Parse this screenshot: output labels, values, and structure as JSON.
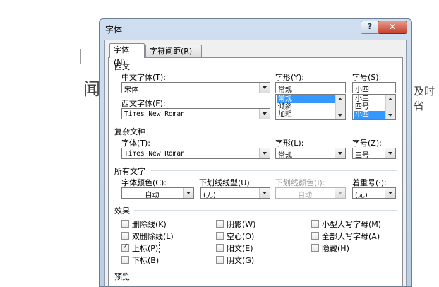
{
  "background": {
    "left_char": "闻",
    "right_text": "及时省"
  },
  "dialog": {
    "title": "字体",
    "help_label": "?",
    "close_label": "✕",
    "tabs": [
      {
        "label": "字体(N)",
        "active": true
      },
      {
        "label": "字符间距(R)",
        "active": false
      }
    ],
    "western": {
      "heading": "西文",
      "chinese_font_label": "中文字体(T):",
      "chinese_font_value": "宋体",
      "western_font_label": "西文字体(F):",
      "western_font_value": "Times New Roman",
      "style_label": "字形(Y):",
      "style_value": "常规",
      "style_options": [
        "常规",
        "倾斜",
        "加粗"
      ],
      "style_selected": "常规",
      "size_label": "字号(S):",
      "size_value": "小四",
      "size_options": [
        "小三",
        "四号",
        "小四"
      ],
      "size_selected": "小四"
    },
    "complex": {
      "heading": "复杂文种",
      "font_label": "字体(T):",
      "font_value": "Times New Roman",
      "style_label": "字形(L):",
      "style_value": "常规",
      "size_label": "字号(Z):",
      "size_value": "三号"
    },
    "all_text": {
      "heading": "所有文字",
      "color_label": "字体颜色(C):",
      "color_value": "自动",
      "underline_type_label": "下划线线型(U):",
      "underline_type_value": "(无)",
      "underline_color_label": "下划线颜色(I):",
      "underline_color_value": "自动",
      "emphasis_label": "着重号(·):",
      "emphasis_value": "(无)"
    },
    "effects": {
      "heading": "效果",
      "col1": [
        {
          "label": "删除线(K)",
          "checked": false
        },
        {
          "label": "双删除线(L)",
          "checked": false
        },
        {
          "label": "上标(P)",
          "checked": true
        },
        {
          "label": "下标(B)",
          "checked": false
        }
      ],
      "col2": [
        {
          "label": "阴影(W)",
          "checked": false
        },
        {
          "label": "空心(O)",
          "checked": false
        },
        {
          "label": "阳文(E)",
          "checked": false
        },
        {
          "label": "阴文(G)",
          "checked": false
        }
      ],
      "col3": [
        {
          "label": "小型大写字母(M)",
          "checked": false
        },
        {
          "label": "全部大写字母(A)",
          "checked": false
        },
        {
          "label": "隐藏(H)",
          "checked": false
        }
      ]
    },
    "preview_heading": "预览"
  }
}
